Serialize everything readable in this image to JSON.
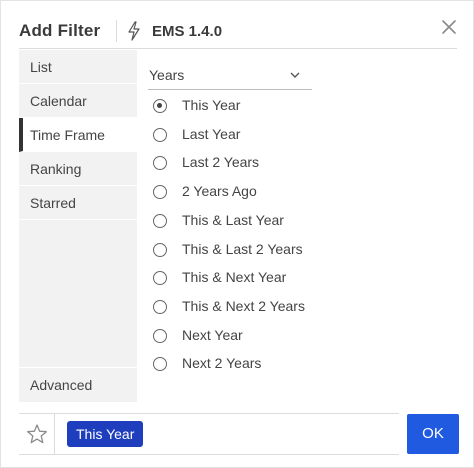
{
  "header": {
    "title": "Add Filter",
    "version": "EMS 1.4.0"
  },
  "sidebar": {
    "items": [
      {
        "label": "List",
        "active": false
      },
      {
        "label": "Calendar",
        "active": false
      },
      {
        "label": "Time Frame",
        "active": true
      },
      {
        "label": "Ranking",
        "active": false
      },
      {
        "label": "Starred",
        "active": false
      }
    ],
    "bottom_label": "Advanced"
  },
  "unit_select": {
    "value": "Years"
  },
  "options": [
    {
      "label": "This Year",
      "selected": true
    },
    {
      "label": "Last Year",
      "selected": false
    },
    {
      "label": "Last 2 Years",
      "selected": false
    },
    {
      "label": "2 Years Ago",
      "selected": false
    },
    {
      "label": "This & Last Year",
      "selected": false
    },
    {
      "label": "This & Last 2 Years",
      "selected": false
    },
    {
      "label": "This & Next Year",
      "selected": false
    },
    {
      "label": "This & Next 2 Years",
      "selected": false
    },
    {
      "label": "Next Year",
      "selected": false
    },
    {
      "label": "Next 2 Years",
      "selected": false
    }
  ],
  "footer": {
    "chip_label": "This Year",
    "ok_label": "OK"
  },
  "colors": {
    "accent": "#1f5ae0",
    "chip": "#1e3ebd"
  },
  "icons": [
    "bolt-icon",
    "close-icon",
    "chevron-down-icon",
    "star-icon"
  ]
}
